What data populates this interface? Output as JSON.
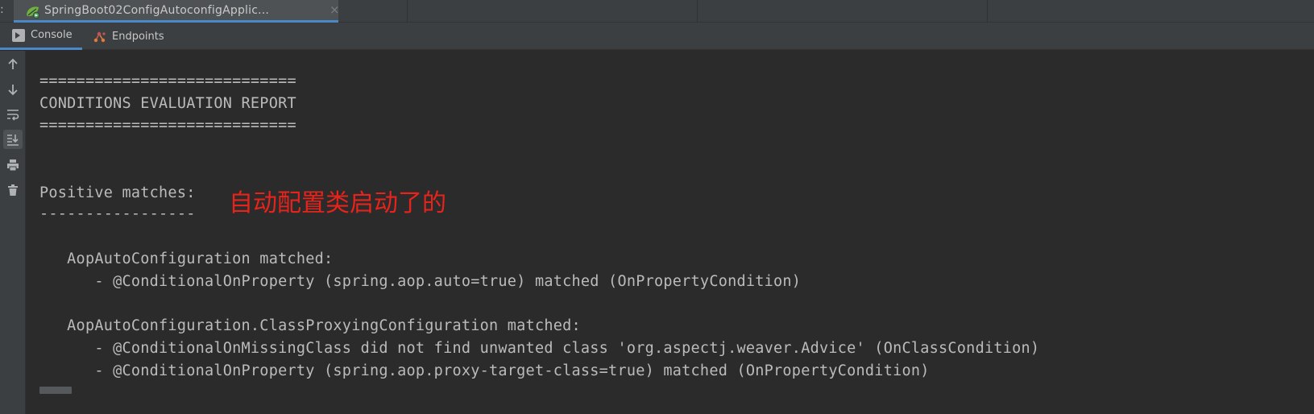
{
  "run_tabs": {
    "overflow_marker": ":",
    "active_tab": {
      "icon": "spring-boot-run-icon",
      "title": "SpringBoot02ConfigAutoconfigApplic...",
      "close_glyph": "×"
    }
  },
  "sub_tabs": [
    {
      "label": "Console",
      "icon": "console-icon",
      "active": true
    },
    {
      "label": "Endpoints",
      "icon": "endpoints-icon",
      "active": false
    }
  ],
  "toolbar": [
    {
      "name": "up-arrow-icon",
      "title": "Up to previous occurrence"
    },
    {
      "name": "down-arrow-icon",
      "title": "Down to next occurrence"
    },
    {
      "name": "soft-wrap-icon",
      "title": "Soft-wrap"
    },
    {
      "name": "scroll-to-end-icon",
      "title": "Scroll to the end",
      "active": true
    },
    {
      "name": "print-icon",
      "title": "Print"
    },
    {
      "name": "trash-icon",
      "title": "Clear all"
    }
  ],
  "console": {
    "lines": [
      "============================",
      "CONDITIONS EVALUATION REPORT",
      "============================",
      "Positive matches:",
      "-----------------",
      "   AopAutoConfiguration matched:",
      "      - @ConditionalOnProperty (spring.aop.auto=true) matched (OnPropertyCondition)",
      "   AopAutoConfiguration.ClassProxyingConfiguration matched:",
      "      - @ConditionalOnMissingClass did not find unwanted class 'org.aspectj.weaver.Advice' (OnClassCondition)",
      "      - @ConditionalOnProperty (spring.aop.proxy-target-class=true) matched (OnPropertyCondition)"
    ],
    "annotation": "自动配置类启动了的"
  },
  "colors": {
    "background": "#2b2b2b",
    "panel": "#3c3f41",
    "text": "#bbbbbb",
    "accent": "#4a88c7",
    "annotation": "#e8231b"
  }
}
